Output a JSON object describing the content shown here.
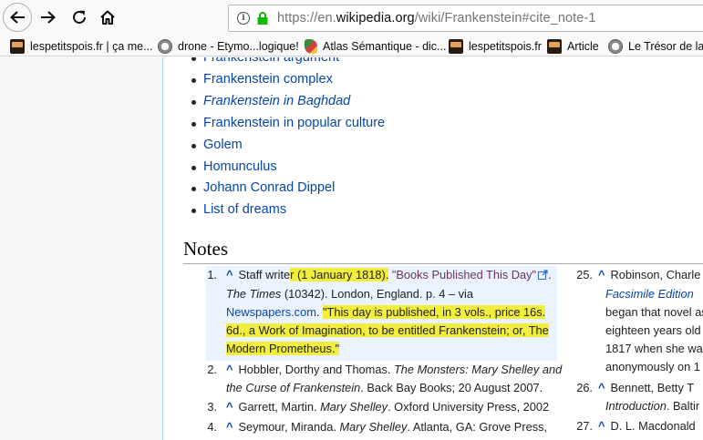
{
  "browser": {
    "url_prefix": "https://en.",
    "url_domain": "wikipedia.org",
    "url_path": "/wiki/Frankenstein#cite_note-1",
    "bookmarks": [
      {
        "label": "lespetitspois.fr | ça me...",
        "icon": "lespetitspois-favicon"
      },
      {
        "label": "drone - Etymo...logique!",
        "icon": "globe-icon"
      },
      {
        "label": "Atlas Sémantique - dic...",
        "icon": "atlas-favicon"
      },
      {
        "label": "lespetitspois.fr",
        "icon": "lespetitspois-favicon"
      },
      {
        "label": "Article",
        "icon": "lespetitspois-favicon"
      },
      {
        "label": "Le Trésor de la L",
        "icon": "globe-icon"
      }
    ]
  },
  "see_also": [
    {
      "label": "Frankenstein argument",
      "italic": false
    },
    {
      "label": "Frankenstein complex",
      "italic": false
    },
    {
      "label": "Frankenstein in Baghdad",
      "italic": true
    },
    {
      "label": "Frankenstein in popular culture",
      "italic": false
    },
    {
      "label": "Golem",
      "italic": false
    },
    {
      "label": "Homunculus",
      "italic": false
    },
    {
      "label": "Johann Conrad Dippel",
      "italic": false
    },
    {
      "label": "List of dreams",
      "italic": false
    }
  ],
  "notes": {
    "heading": "Notes",
    "ref1": {
      "num": "1.",
      "caret": "^",
      "a": "Staff write",
      "b": "r (1 January 1818).",
      "title": "\"Books Published This Day\"",
      "c": ".",
      "times": "The Times",
      "d": " (10342). London, England. p. 4 – via",
      "source": "Newspapers.com",
      "e": ". ",
      "quote1": "\"This day is published, in 3 vols., price 16s.",
      "quote2": "6d., a Work of Imagination, to be entitled Frankenstein; or, The",
      "quote3": "Modern Prometheus.\""
    },
    "ref2": {
      "num": "2.",
      "caret": "^",
      "a": "Hobbler, Dorthy and Thomas. ",
      "b": "The Monsters: Mary Shelley and",
      "c": "the Curse of Frankenstein",
      "d": ". Back Bay Books; 20 August 2007."
    },
    "ref3": {
      "num": "3.",
      "caret": "^",
      "a": "Garrett, Martin. ",
      "b": "Mary Shelley",
      "c": ". Oxford University Press, 2002"
    },
    "ref4": {
      "num": "4.",
      "caret": "^",
      "a": "Seymour, Miranda. ",
      "b": "Mary Shelley",
      "c": ". Atlanta, GA: Grove Press,"
    },
    "ref25": {
      "num": "25.",
      "caret": "^",
      "a": "Robinson, Charle",
      "b": "Facsimile Edition",
      "c": "began that novel as",
      "d": "eighteen years old",
      "e": "1817 when she wa",
      "f": "anonymously on 1"
    },
    "ref26": {
      "num": "26.",
      "caret": "^",
      "a": "Bennett, Betty T",
      "b": "Introduction",
      "c": ". Baltir"
    },
    "ref27": {
      "num": "27.",
      "caret": "^",
      "a": "D. L. Macdonald",
      "b": ""
    }
  }
}
